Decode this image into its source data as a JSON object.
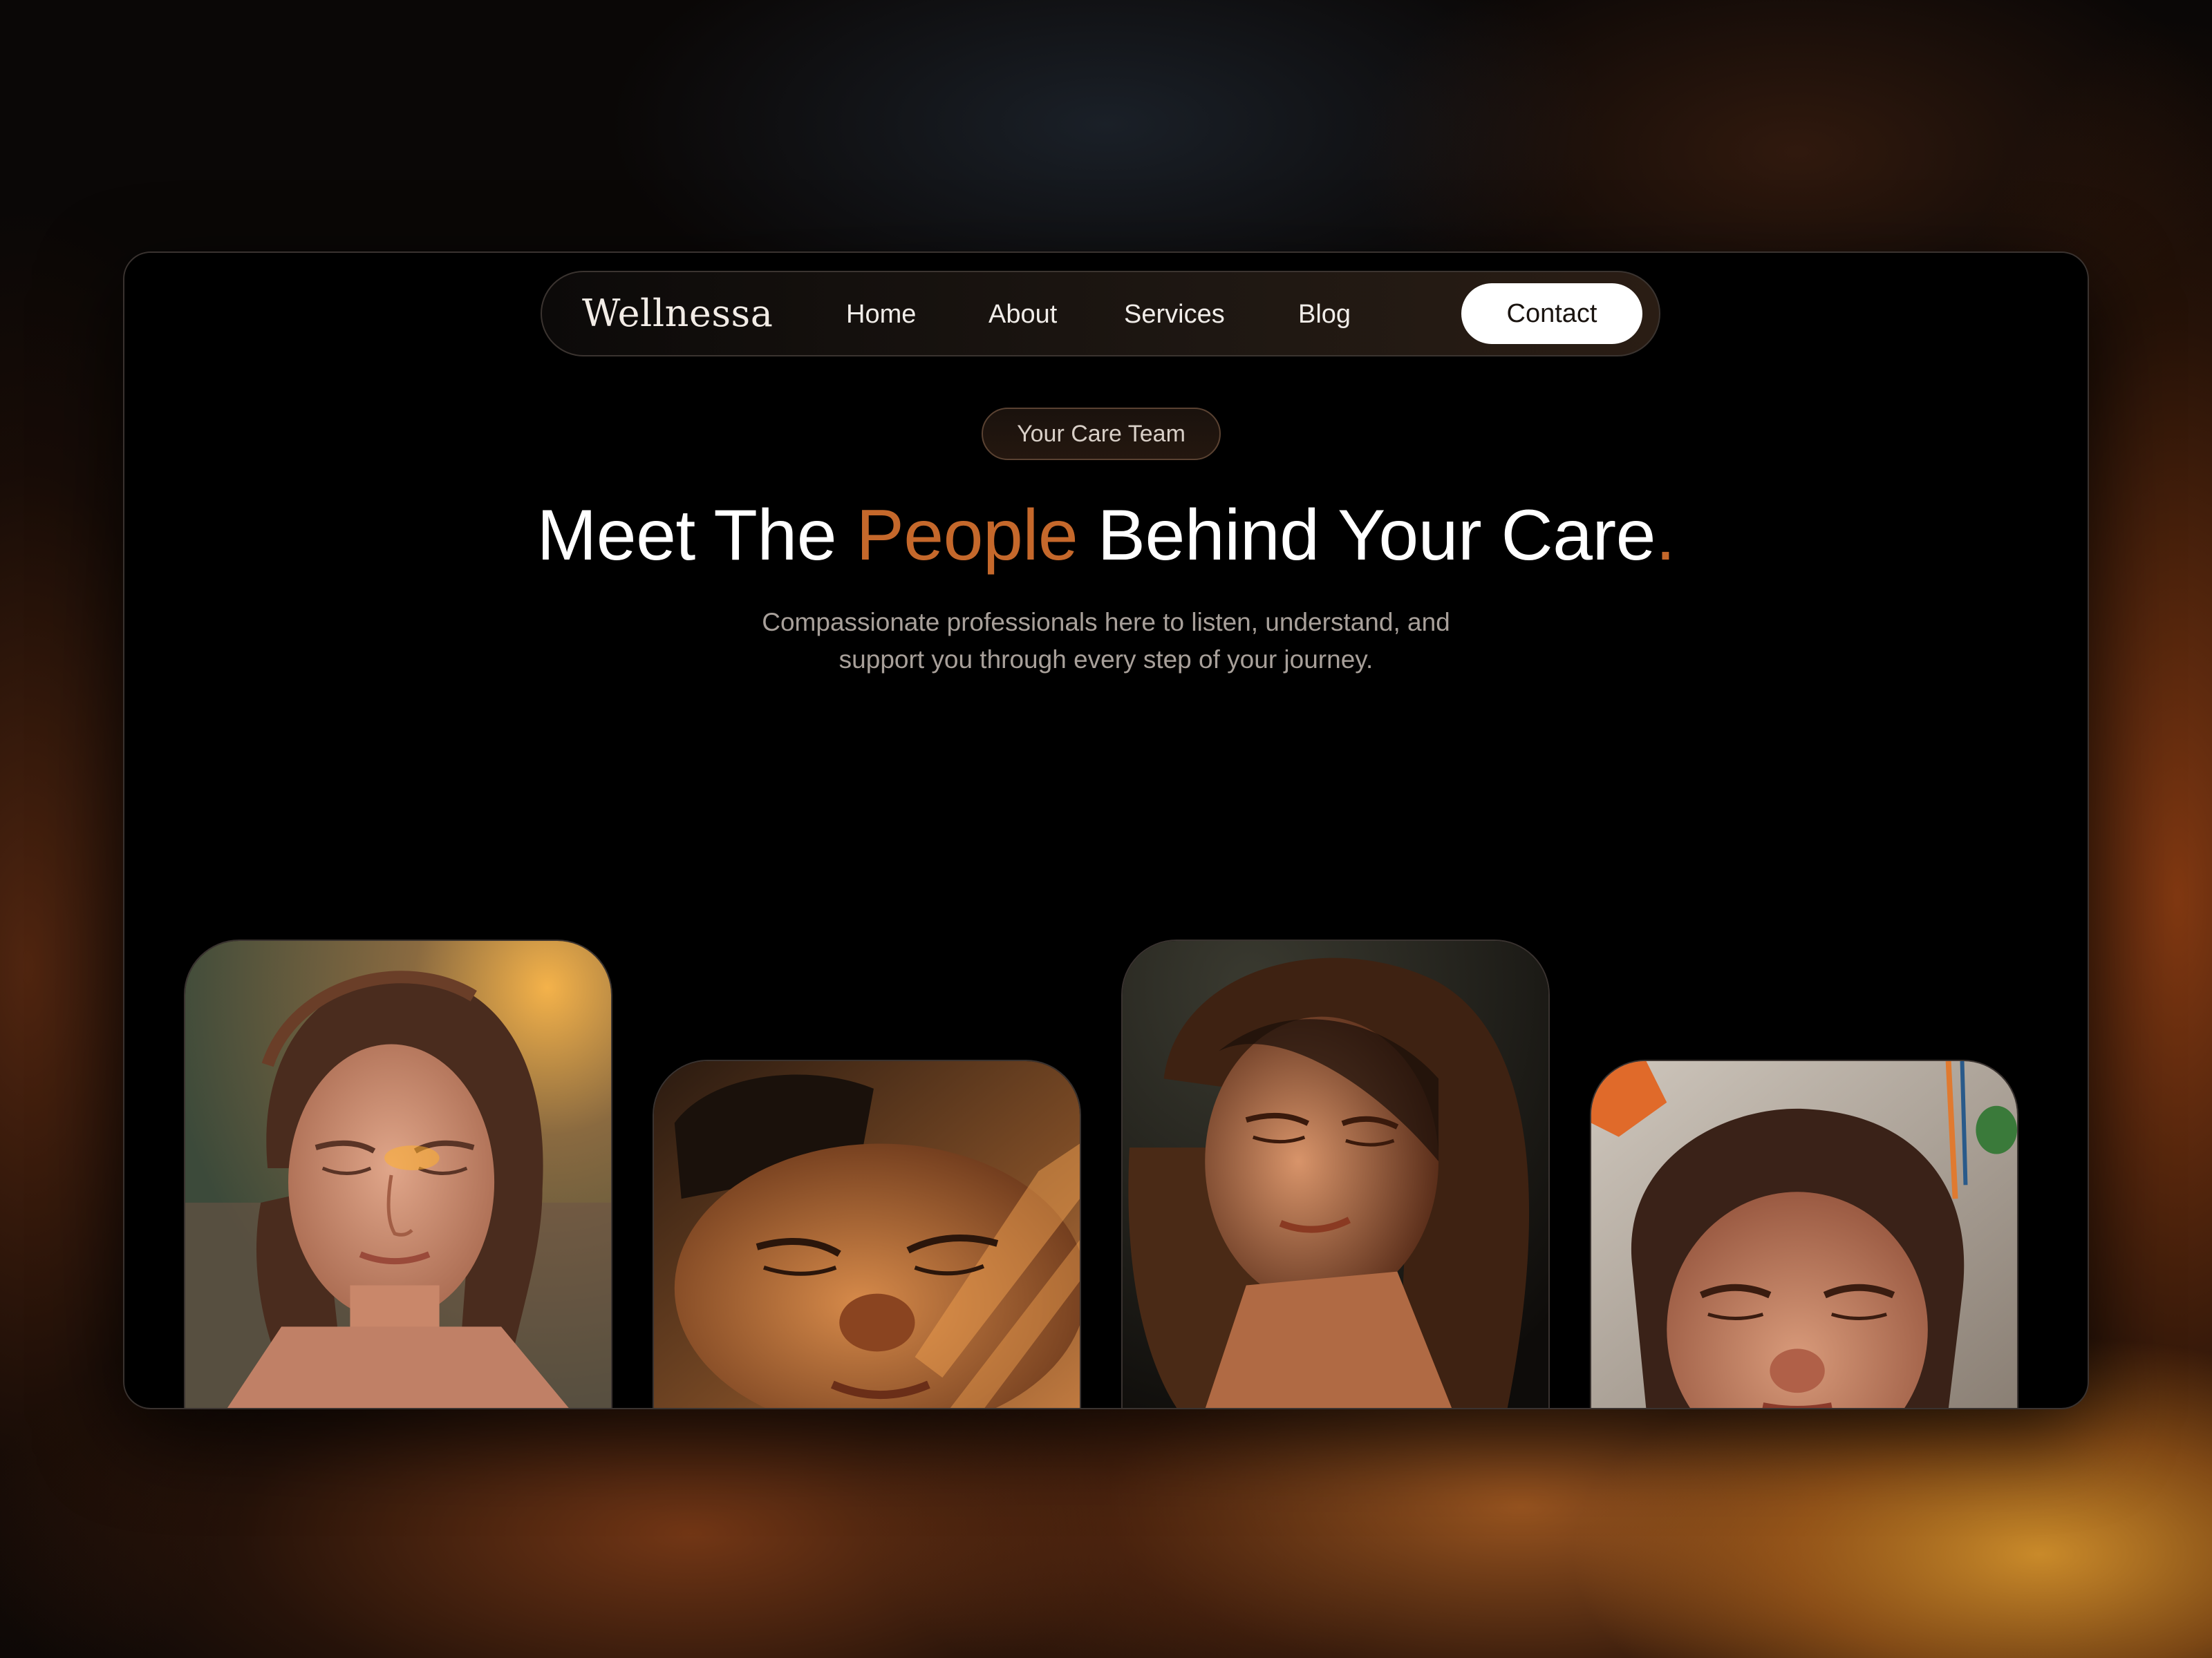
{
  "brand": {
    "logo_text": "Wellnessa"
  },
  "nav": {
    "items": [
      {
        "label": "Home"
      },
      {
        "label": "About"
      },
      {
        "label": "Services"
      },
      {
        "label": "Blog"
      }
    ],
    "cta_label": "Contact"
  },
  "hero": {
    "badge": "Your Care Team",
    "headline": {
      "part1": "Meet The ",
      "accent": "People",
      "part2": " Behind Your Care",
      "period": "."
    },
    "subtitle_line1": "Compassionate professionals here to listen, understand, and",
    "subtitle_line2": "support you through every step of your journey."
  },
  "team_photos": [
    {
      "icon": "portrait-photo"
    },
    {
      "icon": "portrait-photo"
    },
    {
      "icon": "portrait-photo"
    },
    {
      "icon": "portrait-photo"
    }
  ],
  "colors": {
    "accent": "#c5682b",
    "background": "#000000",
    "cta_bg": "#ffffff"
  }
}
